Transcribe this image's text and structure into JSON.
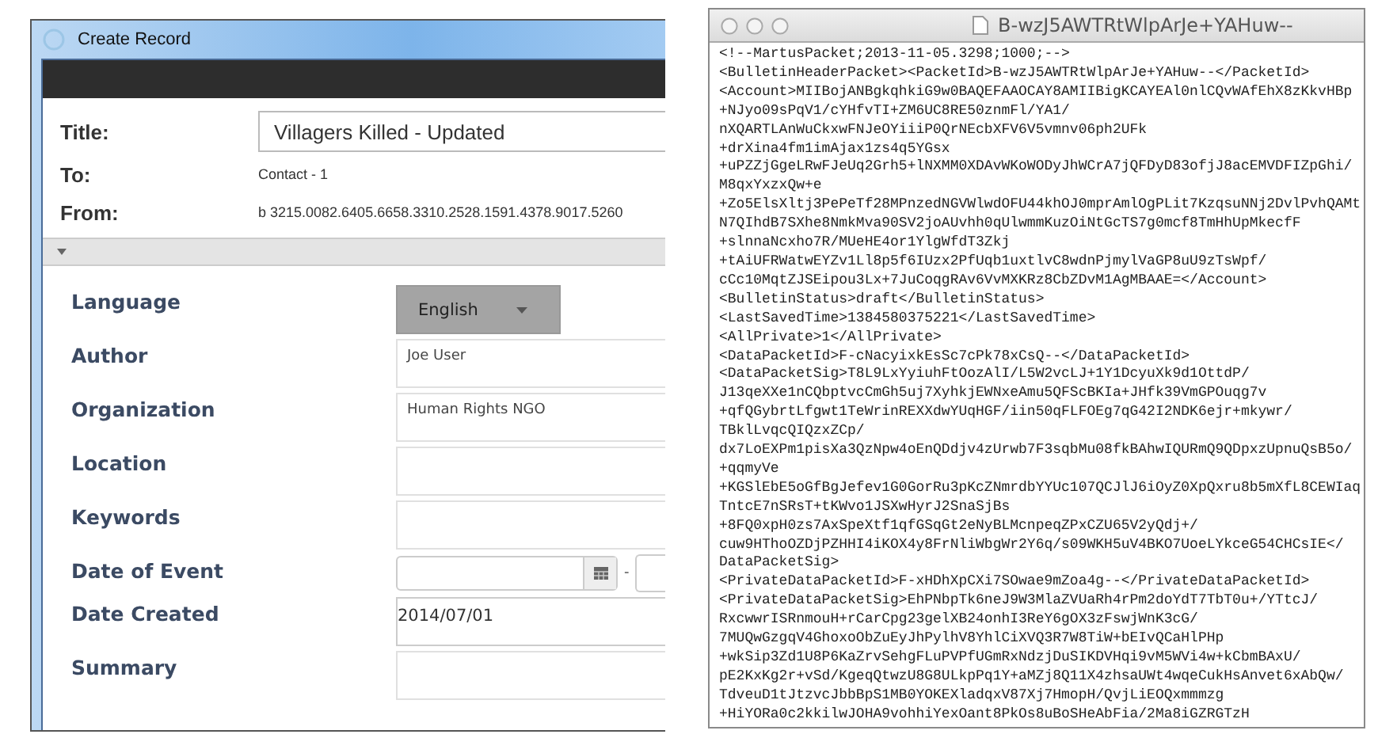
{
  "left_window": {
    "title": "Create Record",
    "header_fields": [
      {
        "label": "Title:",
        "kind": "input",
        "value": "Villagers Killed - Updated"
      },
      {
        "label": "To:",
        "kind": "text",
        "value": "Contact - 1"
      },
      {
        "label": "From:",
        "kind": "text",
        "value": "b 3215.0082.6405.6658.3310.2528.1591.4378.9017.5260"
      }
    ],
    "section": {
      "expanded": true
    },
    "fields": [
      {
        "label": "Language",
        "kind": "select",
        "value": "English"
      },
      {
        "label": "Author",
        "kind": "input",
        "value": "Joe User"
      },
      {
        "label": "Organization",
        "kind": "input",
        "value": "Human Rights NGO"
      },
      {
        "label": "Location",
        "kind": "input"
      },
      {
        "label": "Keywords",
        "kind": "input"
      },
      {
        "label": "Date of Event",
        "kind": "daterange",
        "separator": "-"
      },
      {
        "label": "Date Created",
        "kind": "input",
        "value": "2014/07/01"
      },
      {
        "label": "Summary",
        "kind": "input"
      }
    ]
  },
  "right_window": {
    "title": "B-wzJ5AWTRtWlpArJe+YAHuw--",
    "lines": [
      "<!--MartusPacket;2013-11-05.3298;1000;-->",
      "<BulletinHeaderPacket><PacketId>B-wzJ5AWTRtWlpArJe+YAHuw--</PacketId>",
      "<Account>MIIBojANBgkqhkiG9w0BAQEFAAOCAY8AMIIBigKCAYEAl0nlCQvWAfEhX8zKkvHBp",
      "+NJyo09sPqV1/cYHfvTI+ZM6UC8RE50znmFl/YA1/",
      "nXQARTLAnWuCkxwFNJeOYiiiP0QrNEcbXFV6V5vmnv06ph2UFk",
      "+drXina4fm1imAjax1zs4q5YGsx",
      "+uPZZjGgeLRwFJeUq2Grh5+lNXMM0XDAvWKoWODyJhWCrA7jQFDyD83ofjJ8acEMVDFIZpGhi/",
      "M8qxYxzxQw+e",
      "+Zo5ElsXltj3PePeTf28MPnzedNGVWlwdOFU44khOJ0mprAmlOgPLit7KzqsuNNj2DvlPvhQAMt",
      "N7QIhdB7SXhe8NmkMva90SV2joAUvhh0qUlwmmKuzOiNtGcTS7g0mcf8TmHhUpMkecfF",
      "+slnnaNcxho7R/MUeHE4or1YlgWfdT3Zkj",
      "+tAiUFRWatwEYZv1Ll8p5f6IUzx2PfUqb1uxtlvC8wdnPjmylVaGP8uU9zTsWpf/",
      "cCc10MqtZJSEipou3Lx+7JuCoqgRAv6VvMXKRz8CbZDvM1AgMBAAE=</Account>",
      "<BulletinStatus>draft</BulletinStatus>",
      "<LastSavedTime>1384580375221</LastSavedTime>",
      "<AllPrivate>1</AllPrivate>",
      "<DataPacketId>F-cNacyixkEsSc7cPk78xCsQ--</DataPacketId>",
      "<DataPacketSig>T8L9LxYyiuhFtOozAlI/L5W2vcLJ+1Y1DcyuXk9d1OttdP/",
      "J13qeXXe1nCQbptvcCmGh5uj7XyhkjEWNxeAmu5QFScBKIa+JHfk39VmGPOuqg7v",
      "+qfQGybrtLfgwt1TeWrinREXXdwYUqHGF/iin50qFLFOEg7qG42I2NDK6ejr+mkywr/",
      "TBklLvqcQIQzxZCp/",
      "dx7LoEXPm1pisXa3QzNpw4oEnQDdjv4zUrwb7F3sqbMu08fkBAhwIQURmQ9QDpxzUpnuQsB5o/",
      "+qqmyVe",
      "+KGSlEbE5oGfBgJefev1G0GorRu3pKcZNmrdbYYUc107QCJlJ6iOyZ0XpQxru8b5mXfL8CEWIaq",
      "TntcE7nSRsT+tKWvo1JSXwHyrJ2SnaSjBs",
      "+8FQ0xpH0zs7AxSpeXtf1qfGSqGt2eNyBLMcnpeqZPxCZU65V2yQdj+/",
      "cuw9HThoOZDjPZHHI4iKOX4y8FrNliWbgWr2Y6q/s09WKH5uV4BKO7UoeLYkceG54CHCsIE</",
      "DataPacketSig>",
      "<PrivateDataPacketId>F-xHDhXpCXi7SOwae9mZoa4g--</PrivateDataPacketId>",
      "<PrivateDataPacketSig>EhPNbpTk6neJ9W3MlaZVUaRh4rPm2doYdT7TbT0u+/YTtcJ/",
      "RxcwwrISRnmouH+rCarCpg23gelXB24onhI3ReY6gOX3zFswjWnK3cG/",
      "7MUQwGzgqV4GhoxoObZuEyJhPylhV8YhlCiXVQ3R7W8TiW+bEIvQCaHlPHp",
      "+wkSip3Zd1U8P6KaZrvSehgFLuPVPfUGmRxNdzjDuSIKDVHqi9vM5WVi4w+kCbmBAxU/",
      "pE2KxKg2r+vSd/KgeqQtwzU8G8ULkpPq1Y+aMZj8Q11X4zhsaUWt4wqeCukHsAnvet6xAbQw/",
      "TdveuD1tJtzvcJbbBpS1MB0YOKEXladqxV87Xj7HmopH/QvjLiEOQxmmmzg",
      "+HiYORa0c2kkilwJOHA9vohhiYexOant8PkOs8uBoSHeAbFia/2Ma8iGZRGTzH"
    ]
  }
}
